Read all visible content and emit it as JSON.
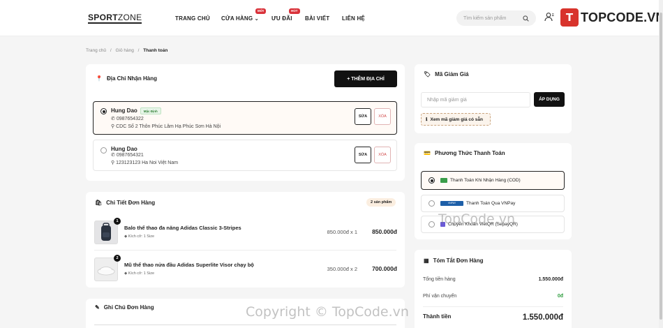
{
  "header": {
    "logo_bold": "SPORT",
    "logo_light": "ZONE",
    "nav": [
      {
        "label": "TRANG CHỦ"
      },
      {
        "label": "CỬA HÀNG",
        "tag": "MỚI"
      },
      {
        "label": "ƯU ĐÃI",
        "tag": "HOT"
      },
      {
        "label": "BÀI VIẾT"
      },
      {
        "label": "LIÊN HỆ"
      }
    ],
    "search_placeholder": "Tìm kiếm sản phẩm",
    "brand_glyph": "T",
    "brand_text": "TOPCODE.VN"
  },
  "breadcrumb": {
    "items": [
      "Trang chủ",
      "Giỏ hàng"
    ],
    "sep": "/",
    "current": "Thanh toán"
  },
  "address": {
    "title": "Địa Chỉ Nhận Hàng",
    "add_button": "+ THÊM ĐỊA CHỈ",
    "entries": [
      {
        "name": "Hung Dao",
        "badge": "Mặc Định",
        "phone": "0987654322",
        "address": "CDC Số 2 Thôn Phúc Lâm Hạ Phúc Sơn Hà Nội",
        "selected": true
      },
      {
        "name": "Hung Dao",
        "badge": "",
        "phone": "0987654321",
        "address": "123123123 Ha Noi Việt Nam",
        "selected": false
      }
    ],
    "edit_label": "SỬA",
    "delete_label": "XÓA"
  },
  "order": {
    "title": "Chi Tiết Đơn Hàng",
    "count_badge": "2 sản phẩm",
    "items": [
      {
        "qty": "1",
        "name": "Balo thể thao đa năng Adidas Classic 3-Stripes",
        "size": "Kích cỡ: 1 Size",
        "unit": "850.000đ x 1",
        "total": "850.000đ"
      },
      {
        "qty": "2",
        "name": "Mũ thể thao nửa đầu Adidas Superlite Visor chạy bộ",
        "size": "Kích cỡ: 1 Size",
        "unit": "350.000đ x 2",
        "total": "700.000đ"
      }
    ]
  },
  "note": {
    "title": "Ghi Chú Đơn Hàng"
  },
  "coupon": {
    "title": "Mã Giảm Giá",
    "placeholder": "Nhập mã giảm giá",
    "apply_button": "ÁP DỤNG",
    "view_codes": "Xem mã giảm giá có sẵn"
  },
  "payment": {
    "title": "Phương Thức Thanh Toán",
    "options": [
      {
        "label": "Thanh Toán Khi Nhận Hàng (COD)",
        "selected": true,
        "logo_color": "#3a9d4a"
      },
      {
        "label": "Thanh Toán Qua VNPay",
        "selected": false,
        "logo_color": "#1d5fa8",
        "logo_text": "VNPAY"
      },
      {
        "label": "Chuyển Khoản VietQR (SepayQR)",
        "selected": false,
        "logo_color": "#6b5bd6"
      }
    ]
  },
  "summary": {
    "title": "Tóm Tắt Đơn Hàng",
    "subtotal_label": "Tổng tiền hàng",
    "subtotal": "1.550.000đ",
    "shipping_label": "Phí vận chuyển",
    "shipping": "0đ",
    "total_label": "Thành tiền",
    "total": "1.550.000đ"
  },
  "watermarks": [
    "TopCode.vn",
    "Copyright © TopCode.vn"
  ],
  "colors": {
    "accent": "#111111",
    "danger": "#d24b4b",
    "success": "#2e9d3e",
    "brand": "#d8332c"
  }
}
